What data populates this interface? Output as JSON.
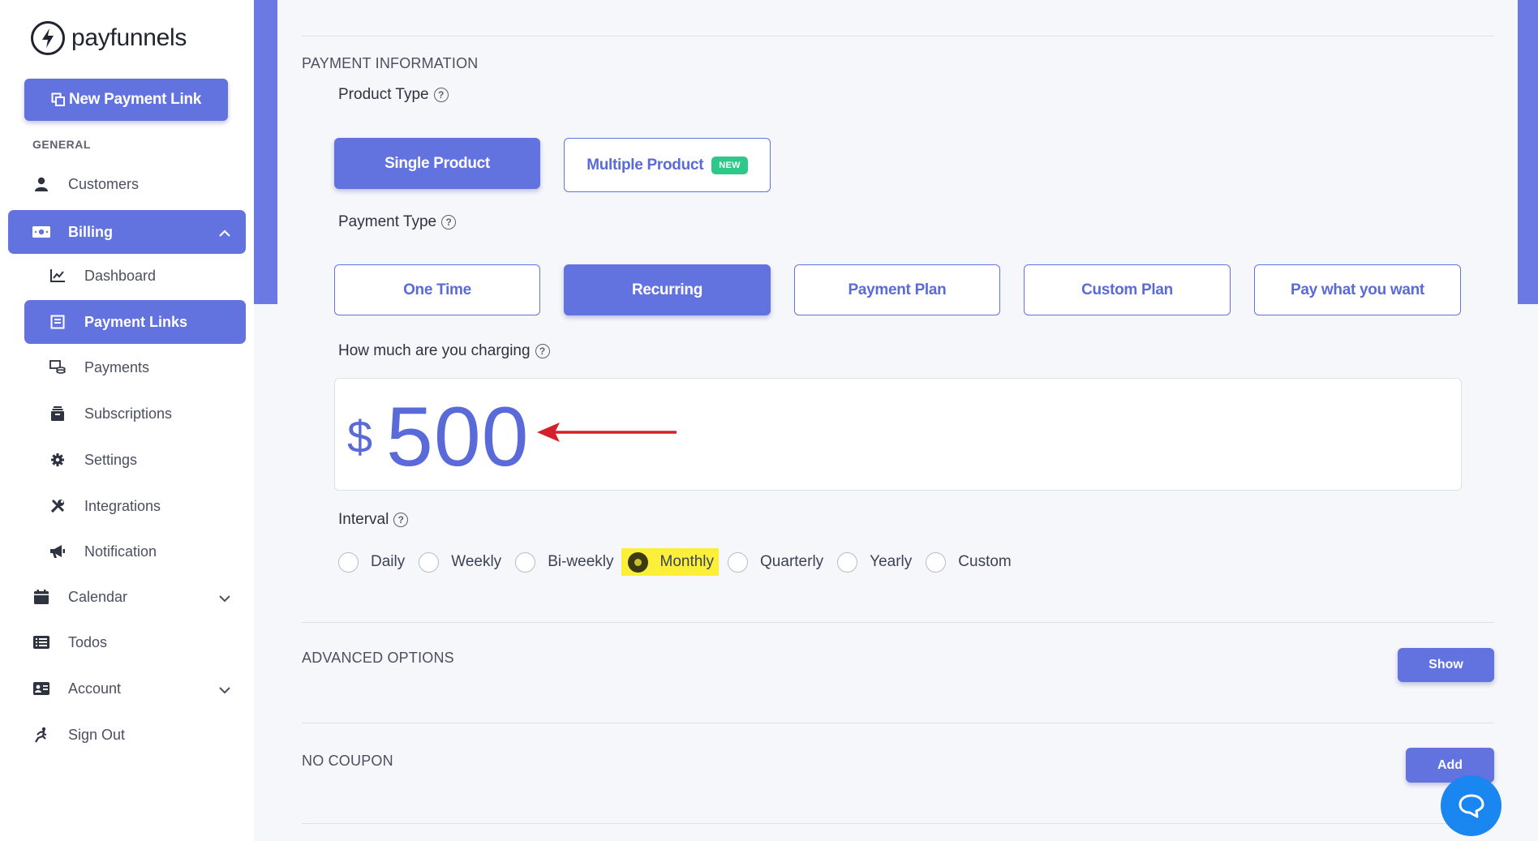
{
  "brand": {
    "name": "payfunnels",
    "logo_icon": "lightning-bolt-icon"
  },
  "sidebar": {
    "new_button": "New Payment Link",
    "section_general": "GENERAL",
    "items": {
      "customers": "Customers",
      "billing": "Billing",
      "dashboard": "Dashboard",
      "payment_links": "Payment Links",
      "payments": "Payments",
      "subscriptions": "Subscriptions",
      "settings": "Settings",
      "integrations": "Integrations",
      "notification": "Notification",
      "calendar": "Calendar",
      "todos": "Todos",
      "account": "Account",
      "sign_out": "Sign Out"
    }
  },
  "form": {
    "section_payment": "PAYMENT INFORMATION",
    "product_type_label": "Product Type",
    "product_types": {
      "single": "Single Product",
      "multiple": "Multiple Product",
      "new_badge": "NEW"
    },
    "payment_type_label": "Payment Type",
    "payment_types": {
      "one_time": "One Time",
      "recurring": "Recurring",
      "payment_plan": "Payment Plan",
      "custom_plan": "Custom Plan",
      "pay_what_you_want": "Pay what you want"
    },
    "selected_payment_type": "Recurring",
    "charge_label": "How much are you charging",
    "currency_symbol": "$",
    "amount": "500",
    "interval_label": "Interval",
    "intervals": {
      "daily": "Daily",
      "weekly": "Weekly",
      "biweekly": "Bi-weekly",
      "monthly": "Monthly",
      "quarterly": "Quarterly",
      "yearly": "Yearly",
      "custom": "Custom"
    },
    "selected_interval": "Monthly",
    "section_advanced": "ADVANCED OPTIONS",
    "show_button": "Show",
    "section_coupon": "NO COUPON",
    "add_button": "Add",
    "help_glyph": "?"
  },
  "colors": {
    "accent": "#6273e0",
    "badge_new": "#2ec98a",
    "highlight": "#fbef3a",
    "annotation_arrow": "#d4202a",
    "chat": "#1a86f0"
  }
}
